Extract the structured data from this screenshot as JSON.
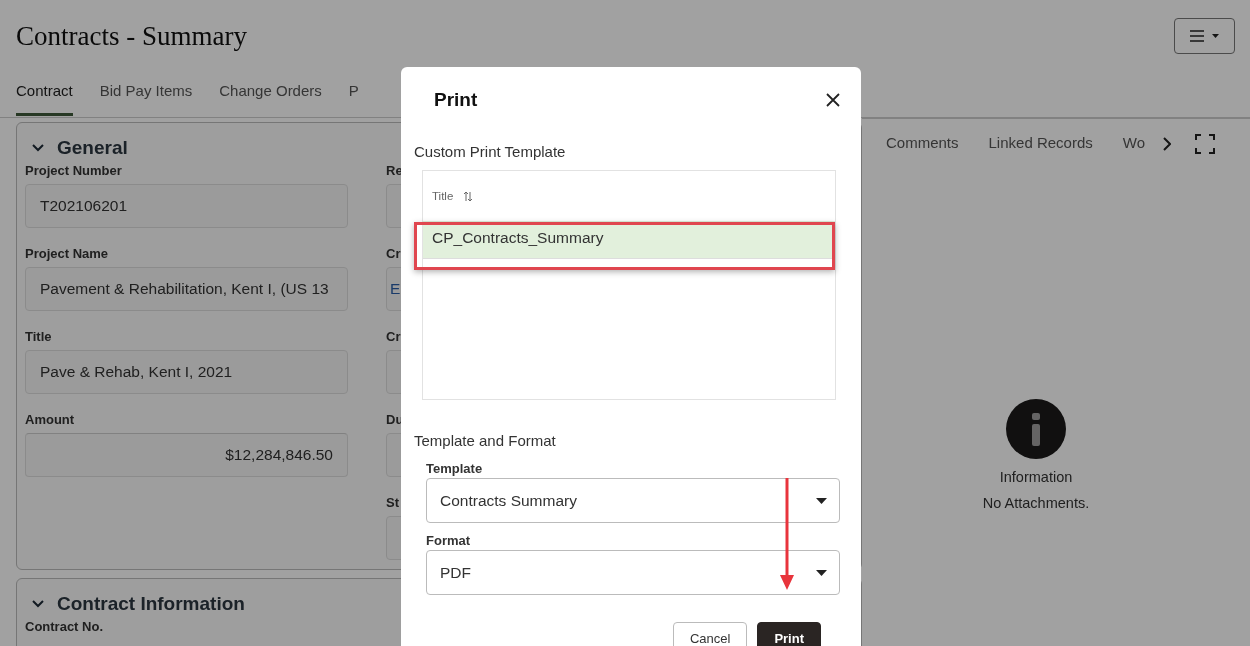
{
  "page": {
    "title": "Contracts - Summary"
  },
  "tabs": [
    {
      "label": "Contract",
      "selected": true
    },
    {
      "label": "Bid Pay Items",
      "selected": false
    },
    {
      "label": "Change Orders",
      "selected": false
    },
    {
      "label": "P",
      "selected": false
    }
  ],
  "general": {
    "heading": "General",
    "expanded": true,
    "fields": [
      {
        "label": "Project Number",
        "value": "T202106201",
        "kind": "text"
      },
      {
        "label": "Project Name",
        "value": "Pavement & Rehabilitation, Kent I, (US 13",
        "kind": "text"
      },
      {
        "label": "Title",
        "value": "Pave & Rehab, Kent I, 2021",
        "kind": "text"
      },
      {
        "label": "Amount",
        "value": "$12,284,846.50",
        "kind": "amount"
      }
    ],
    "fields_2": [
      {
        "label": "Re"
      },
      {
        "label": "Cr",
        "value": "E"
      },
      {
        "label": "Cr"
      },
      {
        "label": "Du"
      },
      {
        "label": "St"
      }
    ]
  },
  "contract_information": {
    "heading": "Contract Information",
    "expanded": true,
    "fields": [
      {
        "label": "Contract No."
      }
    ]
  },
  "side_panel": {
    "tabs": [
      {
        "label": "Comments",
        "selected": false
      },
      {
        "label": "Linked Records",
        "selected": false
      },
      {
        "label": "Wo",
        "selected": false
      }
    ],
    "message_title": "Information",
    "message": "No Attachments."
  },
  "dialog": {
    "title": "Print",
    "section_1": "Custom Print Template",
    "table": {
      "columns": [
        "Title"
      ],
      "rows": [
        {
          "title": "CP_Contracts_Summary",
          "selected": true
        }
      ]
    },
    "section_2": "Template and Format",
    "fields": [
      {
        "label": "Template",
        "value": "Contracts Summary"
      },
      {
        "label": "Format",
        "value": "PDF"
      }
    ],
    "buttons": [
      {
        "label": "Cancel",
        "kind": "secondary"
      },
      {
        "label": "Print",
        "kind": "primary"
      }
    ]
  }
}
